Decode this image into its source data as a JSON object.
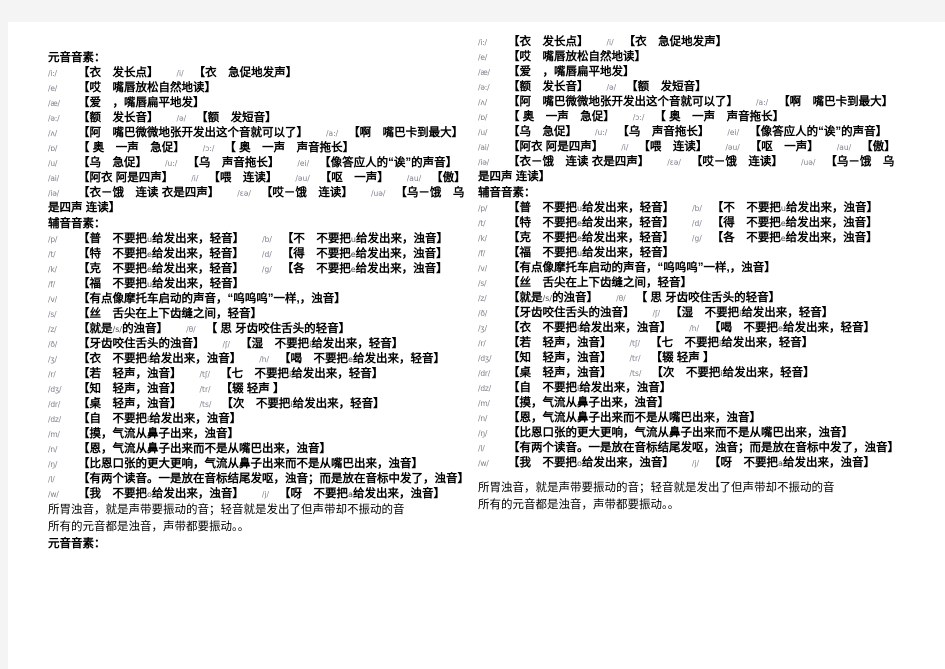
{
  "document": {
    "vowel_header": "元音音素：",
    "consonant_header": "辅音音素：",
    "summary_line_1": "所胃浊音，就是声带要振动的音；轻音就是发出了但声带却不振动的音",
    "summary_line_2": "所有的元音都是浊音，声带都要振动。。",
    "trailing_header": "元音音素："
  },
  "vowels": [
    {
      "ipa": "/i:/",
      "gloss": "【衣　发长点】",
      "ipa2": "/i/",
      "gloss2": "【衣　急促地发声】"
    },
    {
      "ipa": "/e/",
      "gloss": "【哎　嘴唇放松自然地读】",
      "ipa2": "",
      "gloss2": ""
    },
    {
      "ipa": "/æ/",
      "gloss": "【爱　，嘴唇扁平地发】",
      "ipa2": "",
      "gloss2": ""
    },
    {
      "ipa": "/ə:/",
      "gloss": "【额　发长音】",
      "ipa2": "/ə/",
      "gloss2": "【额　发短音】"
    },
    {
      "ipa": "/ʌ/",
      "gloss": "【阿　嘴巴微微地张开发出这个音就可以了】",
      "ipa2": "/a:/",
      "gloss2": "【啊　嘴巴卡到最大】"
    },
    {
      "ipa": "/ɒ/",
      "gloss": "【 奥　一声　急促】",
      "ipa2": "/ɔ:/",
      "gloss2": "【 奥　一声　声音拖长】"
    },
    {
      "ipa": "/u/",
      "gloss": "【乌　急促】",
      "ipa2": "/u:/",
      "gloss2": "【乌　声音拖长】",
      "ipa3": "/ei/",
      "gloss3": "【像答应人的“诶”的声音】"
    },
    {
      "ipa": "/ai/",
      "gloss": "【阿衣 阿是四声】",
      "ipa2": "/i/",
      "gloss2": "【喂　连读】",
      "ipa3": "/əu/",
      "gloss3": "【呕　一声】",
      "ipa4": "/au/",
      "gloss4": "【傲】"
    },
    {
      "ipa": "/iə/",
      "gloss": "【衣－饿　连读 衣是四声】",
      "ipa2": "/ɛə/",
      "gloss2": "【哎－饿　连读】",
      "ipa3": "/uə/",
      "gloss3": "【乌－饿　乌"
    }
  ],
  "vowel_wrap_line": "是四声 连读】",
  "consonants": [
    {
      "ipa": "/p/",
      "gloss": "【普　不要把",
      "mid": "u",
      "gloss_tail": "给发出来，轻音】",
      "ipa2": "/b/",
      "gloss2": "【不　不要把",
      "mid2": "u",
      "gloss2_tail": "给发出来，浊音】"
    },
    {
      "ipa": "/t/",
      "gloss": "【特　不要把",
      "mid": "e",
      "gloss_tail": "给发出来，轻音】",
      "ipa2": "/d/",
      "gloss2": "【得　不要把",
      "mid2": "e",
      "gloss2_tail": "给发出来，浊音】"
    },
    {
      "ipa": "/k/",
      "gloss": "【克　不要把",
      "mid": "e",
      "gloss_tail": "给发出来，轻音】",
      "ipa2": "/g/",
      "gloss2": "【各　不要把",
      "mid2": "e",
      "gloss2_tail": "给发出来，浊音】"
    },
    {
      "ipa": "/f/",
      "gloss": "【福　不要把",
      "mid": "u",
      "gloss_tail": "给发出来，轻音】",
      "ipa2": "",
      "gloss2": ""
    },
    {
      "ipa": "/v/",
      "gloss": "【有点像摩托车启动的声音，“呜呜呜”一样,，浊音】",
      "ipa2": "",
      "gloss2": ""
    },
    {
      "ipa": "/s/",
      "gloss": "【丝　舌尖在上下齿缝之间，轻音】",
      "ipa2": "",
      "gloss2": ""
    },
    {
      "ipa": "/z/",
      "gloss": "【就是",
      "mid": "/s/",
      "gloss_tail": "的浊音】",
      "ipa2": "/θ/",
      "gloss2": "【 思 牙齿咬住舌头的轻音】"
    },
    {
      "ipa": "/ð/",
      "gloss": "【牙齿咬住舌头的浊音】",
      "ipa2": "/ʃ/",
      "gloss2": "【湿　不要把",
      "mid2": "i",
      "gloss2_tail": "给发出来，轻音】"
    },
    {
      "ipa": "/ʒ/",
      "gloss": "【衣　不要把",
      "mid": "i",
      "gloss_tail": "给发出来，浊音】",
      "ipa2": "/h/",
      "gloss2": "【喝　不要把",
      "mid2": "e",
      "gloss2_tail": "给发出来，轻音】"
    },
    {
      "ipa": "/r/",
      "gloss": "【若　轻声，浊音】",
      "ipa2": "/tʃ/",
      "gloss2": "【七　不要把",
      "mid2": "i",
      "gloss2_tail": "给发出来，轻音】"
    },
    {
      "ipa": "/dʒ/",
      "gloss": "【知　轻声，浊音】",
      "ipa2": "/tr/",
      "gloss2": "【辍 轻声 】"
    },
    {
      "ipa": "/dr/",
      "gloss": "【桌　轻声，浊音】",
      "ipa2": "/ts/",
      "gloss2": "【次　不要把",
      "mid2": "i",
      "gloss2_tail": "给发出来，轻音】"
    },
    {
      "ipa": "/dz/",
      "gloss": "【自　不要把",
      "mid": "i",
      "gloss_tail": "给发出来，浊音】",
      "ipa2": "",
      "gloss2": ""
    },
    {
      "ipa": "/m/",
      "gloss": "【摸，气流从鼻子出来，浊音】",
      "ipa2": "",
      "gloss2": ""
    },
    {
      "ipa": "/n/",
      "gloss": "【恩，气流从鼻子出来而不是从嘴巴出来，浊音】",
      "ipa2": "",
      "gloss2": ""
    },
    {
      "ipa": "/ŋ/",
      "gloss": "【比恩口张的更大更响，气流从鼻子出来而不是从嘴巴出来，浊音】",
      "ipa2": "",
      "gloss2": ""
    },
    {
      "ipa": "/l/",
      "gloss": "【有两个读音。一是放在音标结尾发呕，浊音；而是放在音标中发了，浊音】",
      "ipa2": "",
      "gloss2": ""
    },
    {
      "ipa": "/w/",
      "gloss": "【我　不要把",
      "mid": "o",
      "gloss_tail": "给发出来，浊音】",
      "ipa2": "/j/",
      "gloss2": "【呀　不要把",
      "mid2": "a",
      "gloss2_tail": "给发出来，浊音】"
    }
  ],
  "colors": {
    "page_background": "#ffffff",
    "app_background": "#f4f4f5",
    "text": "#000000",
    "ipa_symbol": "#7f7f8c"
  }
}
